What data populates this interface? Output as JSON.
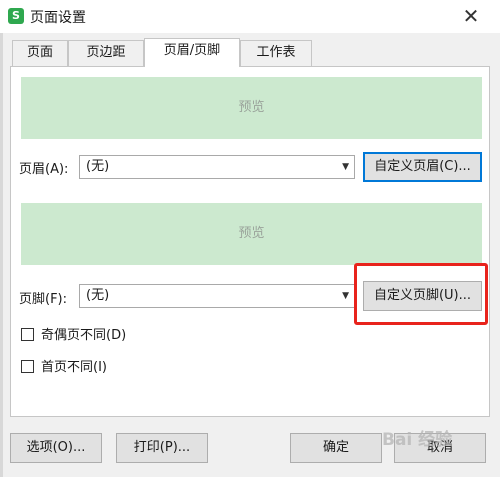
{
  "window": {
    "app_icon_glyph": "S",
    "title": "页面设置",
    "close_glyph": "✕"
  },
  "tabs": [
    {
      "label": "页面"
    },
    {
      "label": "页边距"
    },
    {
      "label": "页眉/页脚",
      "active": true
    },
    {
      "label": "工作表"
    }
  ],
  "header": {
    "preview_text": "预览",
    "label": "页眉(A):",
    "selected_value": "(无)",
    "custom_button": "自定义页眉(C)..."
  },
  "footer": {
    "preview_text": "预览",
    "label": "页脚(F):",
    "selected_value": "(无)",
    "custom_button": "自定义页脚(U)..."
  },
  "options": {
    "odd_even": {
      "label": "奇偶页不同(D)",
      "checked": false
    },
    "first_page": {
      "label": "首页不同(I)",
      "checked": false
    }
  },
  "buttons": {
    "options": "选项(O)...",
    "print": "打印(P)...",
    "ok": "确定",
    "cancel": "取消"
  },
  "watermark_text": "Bai 经验",
  "colors": {
    "preview_bg": "#cce9cf",
    "focus_border": "#0078d7",
    "highlight": "#e8231c",
    "app_icon": "#2fa84f"
  }
}
